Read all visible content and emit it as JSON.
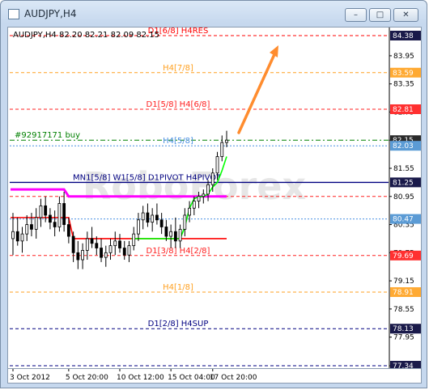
{
  "window": {
    "title": "AUDJPY,H4"
  },
  "window_buttons": {
    "minimize": "–",
    "maximize": "□",
    "close": "✕"
  },
  "colors": {
    "bull": "#000000",
    "red_line": "#ff0000",
    "magenta": "#ff00ff",
    "green": "#00ff00",
    "navy": "#000080",
    "arrow": "#ff8c2e",
    "axis_label_bg_red": "#ff3030",
    "axis_label_bg_orange": "#ffbb44",
    "axis_label_bg_blue": "#5b9bd5"
  },
  "chart_data": {
    "type": "candlestick",
    "symbol_info": "AUDJPY,H4  82.20 82.21 82.09 82.15",
    "watermark": "RoboForex",
    "ylim": [
      77.34,
      84.38
    ],
    "y_ticks": [
      "83.95",
      "83.35",
      "82.75",
      "82.15",
      "81.55",
      "80.95",
      "80.35",
      "79.75",
      "79.15",
      "78.55",
      "77.95",
      "77.34"
    ],
    "x_ticks": [
      "3 Oct 2012",
      "5 Oct 20:00",
      "10 Oct 12:00",
      "15 Oct 04:00",
      "17 Oct 20:00"
    ],
    "levels": [
      {
        "label": "D1[6/8] H4RES",
        "value": 84.38,
        "color": "#ff0000",
        "style": "dash",
        "axis_label": "84.38",
        "axis_bg": "#1a1a4a"
      },
      {
        "label": "H4[7/8]",
        "value": 83.59,
        "color": "#ffa020",
        "style": "dash",
        "axis_label": "83.59",
        "axis_bg": "#ffaa33"
      },
      {
        "label": "D1[5/8] H4[6/8]",
        "value": 82.81,
        "color": "#ff2020",
        "style": "dash",
        "axis_label": "82.81",
        "axis_bg": "#ff3030"
      },
      {
        "label": "#92917171 buy",
        "value": 82.15,
        "color": "#008000",
        "style": "dashdot",
        "axis_label": "82.15",
        "axis_bg": "#2a2a2a"
      },
      {
        "label": "H4[5/8]",
        "value": 82.03,
        "color": "#4a90e2",
        "style": "dot",
        "axis_label": "82.03",
        "axis_bg": "#5b9bd5"
      },
      {
        "label": "MN1[5/8] W1[5/8] D1PIVOT H4PIVOT",
        "value": 81.25,
        "color": "#000080",
        "style": "solid",
        "axis_label": "81.25",
        "axis_bg": "#1a1a4a"
      },
      {
        "label": "",
        "value": 80.95,
        "color": "#ff2020",
        "style": "dash",
        "axis_label": "",
        "axis_bg": ""
      },
      {
        "label": "",
        "value": 80.47,
        "color": "#4a90e2",
        "style": "dot",
        "axis_label": "80.47",
        "axis_bg": "#5b9bd5"
      },
      {
        "label": "D1[3/8] H4[2/8]",
        "value": 79.69,
        "color": "#ff2020",
        "style": "dash",
        "axis_label": "79.69",
        "axis_bg": "#ff3030"
      },
      {
        "label": "H4[1/8]",
        "value": 78.91,
        "color": "#ffa020",
        "style": "dash",
        "axis_label": "78.91",
        "axis_bg": "#ffaa33"
      },
      {
        "label": "D1[2/8] H4SUP",
        "value": 78.13,
        "color": "#000080",
        "style": "dash",
        "axis_label": "78.13",
        "axis_bg": "#1a1a4a"
      },
      {
        "label": "",
        "value": 77.34,
        "color": "#000080",
        "style": "dash",
        "axis_label": "77.34",
        "axis_bg": "#1a1a4a"
      }
    ],
    "candles": [
      [
        80.05,
        80.6,
        79.7,
        80.2
      ],
      [
        80.2,
        80.5,
        79.9,
        80.0
      ],
      [
        80.0,
        80.3,
        79.75,
        80.15
      ],
      [
        80.15,
        80.55,
        80.0,
        80.35
      ],
      [
        80.35,
        80.6,
        80.1,
        80.25
      ],
      [
        80.25,
        80.7,
        80.05,
        80.5
      ],
      [
        80.5,
        80.9,
        80.3,
        80.75
      ],
      [
        80.75,
        80.95,
        80.4,
        80.55
      ],
      [
        80.55,
        80.7,
        80.25,
        80.4
      ],
      [
        80.4,
        80.65,
        80.1,
        80.3
      ],
      [
        80.3,
        80.95,
        80.2,
        80.8
      ],
      [
        80.8,
        81.05,
        80.2,
        80.35
      ],
      [
        80.35,
        80.5,
        79.95,
        80.1
      ],
      [
        80.1,
        80.2,
        79.55,
        79.75
      ],
      [
        79.75,
        80.0,
        79.4,
        79.6
      ],
      [
        79.6,
        79.95,
        79.4,
        79.8
      ],
      [
        79.8,
        80.2,
        79.6,
        80.05
      ],
      [
        80.05,
        80.3,
        79.85,
        79.95
      ],
      [
        79.95,
        80.1,
        79.7,
        79.85
      ],
      [
        79.85,
        80.05,
        79.55,
        79.65
      ],
      [
        79.65,
        79.9,
        79.45,
        79.75
      ],
      [
        79.75,
        80.05,
        79.6,
        79.9
      ],
      [
        79.9,
        80.2,
        79.7,
        80.0
      ],
      [
        80.0,
        80.15,
        79.75,
        79.85
      ],
      [
        79.85,
        80.0,
        79.6,
        79.7
      ],
      [
        79.7,
        80.0,
        79.55,
        79.9
      ],
      [
        79.9,
        80.3,
        79.8,
        80.15
      ],
      [
        80.15,
        80.6,
        80.0,
        80.45
      ],
      [
        80.45,
        80.75,
        80.25,
        80.6
      ],
      [
        80.6,
        80.8,
        80.3,
        80.4
      ],
      [
        80.4,
        80.7,
        80.2,
        80.55
      ],
      [
        80.55,
        80.8,
        80.35,
        80.45
      ],
      [
        80.45,
        80.6,
        80.15,
        80.3
      ],
      [
        80.3,
        80.45,
        80.0,
        80.1
      ],
      [
        80.1,
        80.35,
        79.85,
        80.2
      ],
      [
        80.2,
        80.5,
        79.85,
        80.0
      ],
      [
        80.0,
        80.35,
        79.85,
        80.25
      ],
      [
        80.25,
        80.7,
        80.1,
        80.55
      ],
      [
        80.55,
        80.85,
        80.4,
        80.7
      ],
      [
        80.7,
        80.95,
        80.55,
        80.85
      ],
      [
        80.85,
        81.05,
        80.7,
        80.95
      ],
      [
        80.95,
        81.1,
        80.8,
        81.0
      ],
      [
        81.0,
        81.3,
        80.85,
        81.2
      ],
      [
        81.2,
        81.55,
        81.05,
        81.45
      ],
      [
        81.45,
        81.9,
        81.3,
        81.8
      ],
      [
        81.8,
        82.25,
        81.7,
        82.1
      ],
      [
        82.1,
        82.35,
        82.0,
        82.15
      ]
    ],
    "x_tick_candles": [
      0,
      12,
      23,
      34,
      43
    ],
    "indicators": {
      "red": [
        80.5,
        80.5,
        80.5,
        80.5,
        80.5,
        80.5,
        80.5,
        80.5,
        80.5,
        80.5,
        80.5,
        80.5,
        80.5,
        80.05,
        80.05,
        80.05,
        80.05,
        80.05,
        80.05,
        80.05,
        80.05,
        80.05,
        80.05,
        80.05,
        80.05,
        80.05,
        80.05,
        80.05,
        80.05,
        80.05,
        80.05,
        80.05,
        80.05,
        80.05,
        80.05,
        80.05,
        80.05,
        80.05,
        80.05,
        80.05,
        80.05,
        80.05,
        80.05,
        80.05,
        80.05,
        80.05,
        80.05
      ],
      "magenta": [
        81.1,
        81.1,
        81.1,
        81.1,
        81.1,
        81.1,
        81.1,
        81.1,
        81.1,
        81.1,
        81.1,
        81.1,
        80.95,
        80.95,
        80.95,
        80.95,
        80.95,
        80.95,
        80.95,
        80.95,
        80.95,
        80.95,
        80.95,
        80.95,
        80.95,
        80.95,
        80.95,
        80.95,
        80.95,
        80.95,
        80.95,
        80.95,
        80.95,
        80.95,
        80.95,
        80.95,
        80.95,
        80.95,
        80.95,
        80.95,
        80.95,
        80.95,
        80.95,
        80.95,
        80.95,
        80.95,
        80.95
      ],
      "green": [
        null,
        null,
        null,
        null,
        null,
        null,
        null,
        null,
        null,
        null,
        null,
        null,
        null,
        null,
        null,
        null,
        null,
        null,
        null,
        null,
        null,
        null,
        null,
        null,
        null,
        null,
        80.05,
        80.05,
        80.05,
        80.05,
        80.05,
        80.05,
        80.05,
        80.05,
        80.05,
        80.05,
        80.05,
        80.3,
        80.7,
        80.9,
        80.95,
        80.95,
        81.0,
        81.15,
        81.25,
        81.5,
        81.8
      ]
    }
  }
}
